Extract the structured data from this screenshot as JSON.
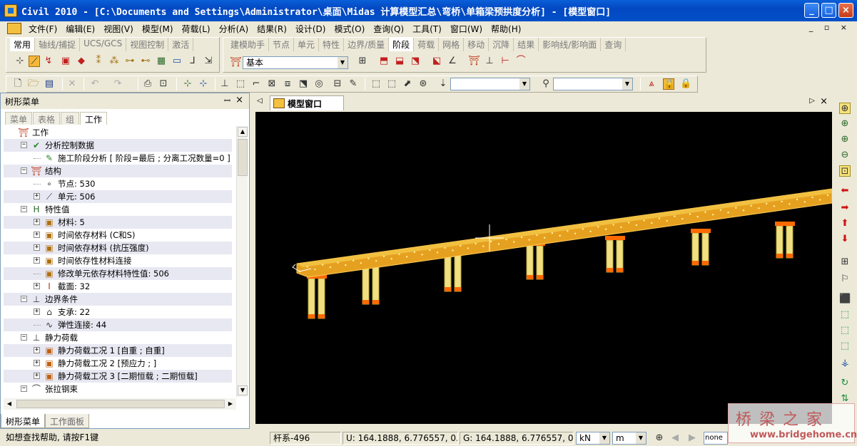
{
  "window": {
    "title": "Civil 2010 - [C:\\Documents and Settings\\Administrator\\桌面\\Midas 计算模型汇总\\弯桥\\单箱梁预拱度分析] - [模型窗口]",
    "controls": {
      "minimize": "_",
      "maximize": "□",
      "close": "×"
    }
  },
  "menu": {
    "items": [
      "文件(F)",
      "编辑(E)",
      "视图(V)",
      "模型(M)",
      "荷载(L)",
      "分析(A)",
      "结果(R)",
      "设计(D)",
      "模式(O)",
      "查询(Q)",
      "工具(T)",
      "窗口(W)",
      "帮助(H)"
    ],
    "mdi": "_ ▫ ×"
  },
  "ribbon_tabs_left": [
    "常用",
    "轴线/捕捉",
    "UCS/GCS",
    "视图控制",
    "激活"
  ],
  "ribbon_tabs_right": [
    "建模助手",
    "节点",
    "单元",
    "特性",
    "边界/质量",
    "阶段",
    "荷载",
    "网格",
    "移动",
    "沉降",
    "结果",
    "影响线/影响面",
    "查询"
  ],
  "stage_combo": {
    "value": "基本"
  },
  "left_panel": {
    "title": "树形菜单",
    "pin": "ꟷ",
    "close": "×",
    "tabs": [
      "菜单",
      "表格",
      "组",
      "工作"
    ],
    "bottom_tabs": [
      "树形菜单",
      "工作面板"
    ],
    "tree": [
      {
        "level": 0,
        "exp": "",
        "icon": "⛩",
        "text": "工作",
        "color": "#c04020"
      },
      {
        "level": 1,
        "exp": "−",
        "icon": "✔",
        "text": "分析控制数据",
        "color": "#2a8a2a"
      },
      {
        "level": 2,
        "exp": "",
        "icon": "✎",
        "text": "施工阶段分析 [ 阶段=最后 ; 分离工况数量=0 ]",
        "color": "#2a8a2a"
      },
      {
        "level": 1,
        "exp": "−",
        "icon": "⛩",
        "text": "结构",
        "color": "#c04020"
      },
      {
        "level": 2,
        "exp": "",
        "icon": "∘",
        "text": "节点: 530",
        "color": "#333"
      },
      {
        "level": 2,
        "exp": "+",
        "icon": "⟋",
        "text": "单元: 506",
        "color": "#333"
      },
      {
        "level": 1,
        "exp": "−",
        "icon": "H",
        "text": "特性值",
        "color": "#2a6a2a"
      },
      {
        "level": 2,
        "exp": "+",
        "icon": "▣",
        "text": "材料: 5",
        "color": "#b07010"
      },
      {
        "level": 2,
        "exp": "+",
        "icon": "▣",
        "text": "时间依存材料 (C和S)",
        "color": "#b07010"
      },
      {
        "level": 2,
        "exp": "+",
        "icon": "▣",
        "text": "时间依存材料 (抗压强度)",
        "color": "#b07010"
      },
      {
        "level": 2,
        "exp": "+",
        "icon": "▣",
        "text": "时间依存性材料连接",
        "color": "#b07010"
      },
      {
        "level": 2,
        "exp": "",
        "icon": "▣",
        "text": "修改单元依存材料特性值: 506",
        "color": "#b07010"
      },
      {
        "level": 2,
        "exp": "+",
        "icon": "I",
        "text": "截面: 32",
        "color": "#c03010"
      },
      {
        "level": 1,
        "exp": "−",
        "icon": "⊥",
        "text": "边界条件",
        "color": "#333"
      },
      {
        "level": 2,
        "exp": "+",
        "icon": "⌂",
        "text": "支承: 22",
        "color": "#333"
      },
      {
        "level": 2,
        "exp": "",
        "icon": "∿",
        "text": "弹性连接: 44",
        "color": "#333"
      },
      {
        "level": 1,
        "exp": "−",
        "icon": "⊥",
        "text": "静力荷载",
        "color": "#333"
      },
      {
        "level": 2,
        "exp": "+",
        "icon": "▣",
        "text": "静力荷载工况 1 [自重 ; 自重]",
        "color": "#c06010"
      },
      {
        "level": 2,
        "exp": "+",
        "icon": "▣",
        "text": "静力荷载工况 2 [预应力 ; ]",
        "color": "#c06010"
      },
      {
        "level": 2,
        "exp": "+",
        "icon": "▣",
        "text": "静力荷载工况 3 [二期恒载 ; 二期恒载]",
        "color": "#c06010"
      },
      {
        "level": 1,
        "exp": "−",
        "icon": "⌒",
        "text": "张拉钢束",
        "color": "#333"
      }
    ]
  },
  "doc_tab": {
    "label": "模型窗口",
    "nav_right": "▷",
    "close": "×",
    "nav_left": "◁"
  },
  "status": {
    "help": "如想查找帮助, 请按F1键",
    "element": "杆系-496",
    "ucs": "U: 164.1888, 6.776557, 0.2",
    "gcs": "G: 164.1888, 6.776557, 0.2",
    "force_unit": "kN",
    "length_unit": "m",
    "none_combo": "none"
  },
  "watermark": {
    "text": "桥 梁 之 家",
    "url": "www.bridgehome.cn"
  },
  "colors": {
    "deck": "#e6a020",
    "pier": "#f0e080",
    "viewport_bg": "#000000",
    "title_blue": "#0348c2"
  }
}
